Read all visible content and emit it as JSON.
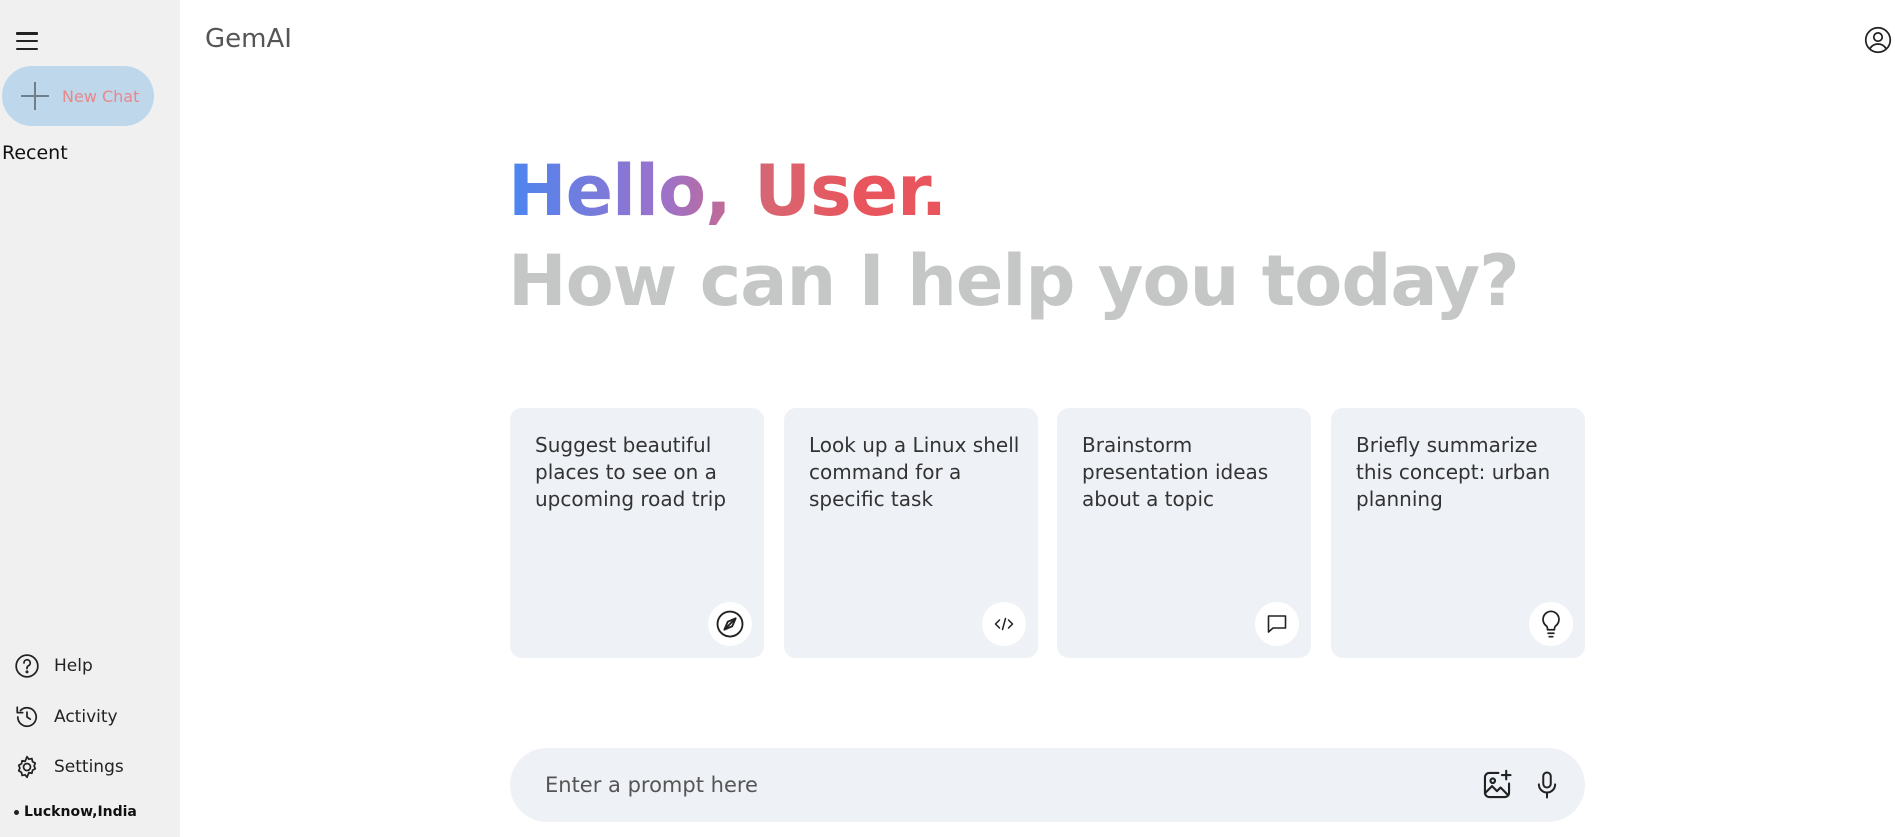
{
  "header": {
    "brand": "GemAI"
  },
  "sidebar": {
    "new_chat_label": "New Chat",
    "recent_label": "Recent",
    "bottom_items": [
      {
        "label": "Help",
        "icon": "help-circle-icon"
      },
      {
        "label": "Activity",
        "icon": "history-icon"
      },
      {
        "label": "Settings",
        "icon": "gear-icon"
      }
    ],
    "location": "Lucknow,India"
  },
  "greeting": {
    "hello": "Hello, User.",
    "subtitle": "How can I help you today?"
  },
  "cards": [
    {
      "text": "Suggest beautiful places to see on a upcoming road trip",
      "icon": "compass-icon"
    },
    {
      "text": "Look up a Linux shell command for a specific task",
      "icon": "code-icon"
    },
    {
      "text": "Brainstorm presentation ideas about a topic",
      "icon": "message-icon"
    },
    {
      "text": "Briefly summarize this concept: urban planning",
      "icon": "lightbulb-icon"
    }
  ],
  "prompt": {
    "placeholder": "Enter a prompt here",
    "value": ""
  },
  "colors": {
    "sidebar_bg": "#f0f0f0",
    "new_chat_bg": "#bfd7ea",
    "new_chat_text": "#e8878a",
    "card_bg": "#eef1f6",
    "gradient_start": "#4a86f0",
    "gradient_end": "#e8555c",
    "subtitle": "#c4c7c5"
  }
}
